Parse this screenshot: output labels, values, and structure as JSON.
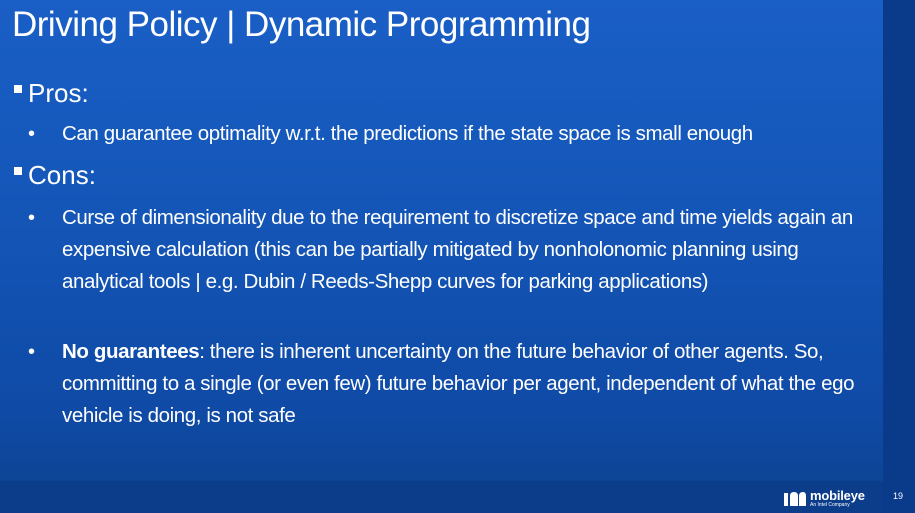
{
  "slide": {
    "title": "Driving Policy | Dynamic Programming",
    "sections": {
      "pros_label": "Pros:",
      "cons_label": "Cons:"
    },
    "pros": [
      {
        "bullet": "•",
        "text": "Can guarantee optimality w.r.t. the predictions if the state space is small enough"
      }
    ],
    "cons": [
      {
        "bullet": "•",
        "text": "Curse of dimensionality due to the requirement to discretize space and time yields again an expensive calculation (this can be partially mitigated by nonholonomic planning using analytical tools | e.g. Dubin / Reeds-Shepp curves for parking applications)"
      },
      {
        "bullet": "•",
        "bold": "No guarantees",
        "text": ": there is inherent uncertainty on the future behavior of other agents. So, committing to a single (or even few) future behavior per agent, independent of what the ego vehicle is doing, is not safe"
      }
    ]
  },
  "footer": {
    "logo_name": "mobileye",
    "logo_sub": "An Intel Company",
    "logo_icon": "mobileye-logo-icon",
    "page_number": "19"
  },
  "colors": {
    "background_top": "#1a5fc6",
    "background_bottom": "#0c438f",
    "side_band": "#0a3b8a",
    "text": "#ffffff"
  }
}
